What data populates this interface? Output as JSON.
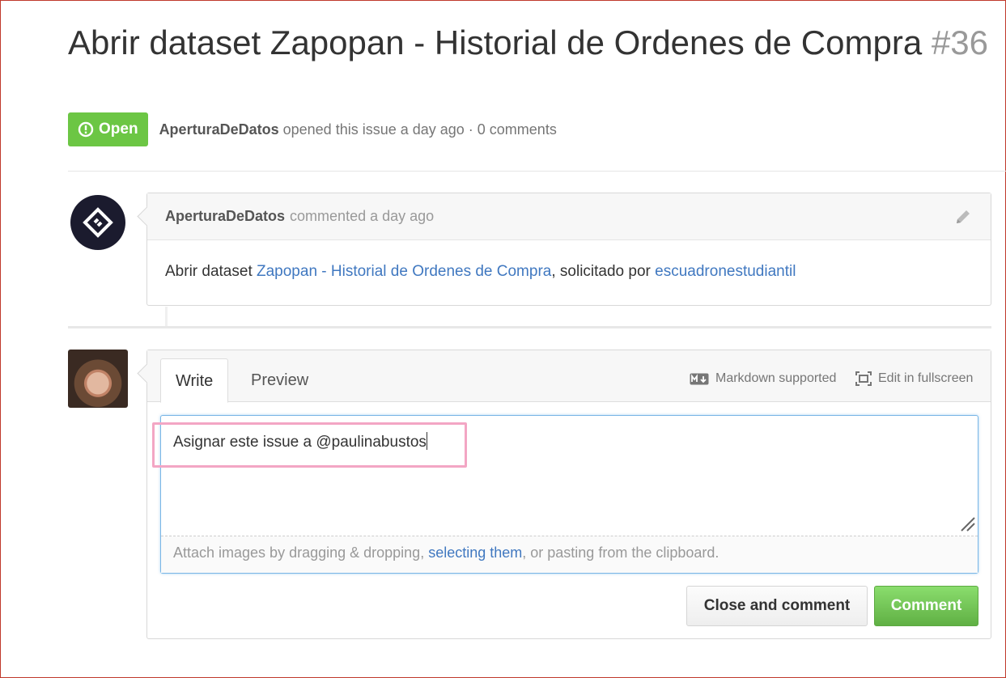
{
  "issue": {
    "title": "Abrir dataset Zapopan - Historial de Ordenes de Compra",
    "number": "#36",
    "state": "Open",
    "author": "AperturaDeDatos",
    "opened_text": "opened this issue a day ago · 0 comments"
  },
  "comment": {
    "author": "AperturaDeDatos",
    "meta": "commented a day ago",
    "body_prefix": "Abrir dataset ",
    "body_link1": "Zapopan - Historial de Ordenes de Compra",
    "body_middle": ", solicitado por ",
    "body_link2": "escuadronestudiantil"
  },
  "compose": {
    "tab_write": "Write",
    "tab_preview": "Preview",
    "markdown_label": "Markdown supported",
    "fullscreen_label": "Edit in fullscreen",
    "text": "Asignar este issue a @paulinabustos",
    "attach_prefix": "Attach images by dragging & dropping, ",
    "attach_link": "selecting them",
    "attach_suffix": ", or pasting from the clipboard.",
    "close_button": "Close and comment",
    "comment_button": "Comment"
  },
  "colors": {
    "open_green": "#6cc644",
    "link_blue": "#4078c0",
    "highlight_pink": "#f3a6c4"
  },
  "icons": [
    "issue-opened-icon",
    "avatar-logo-icon",
    "pencil-icon",
    "markdown-icon",
    "fullscreen-icon",
    "resize-grip-icon"
  ]
}
